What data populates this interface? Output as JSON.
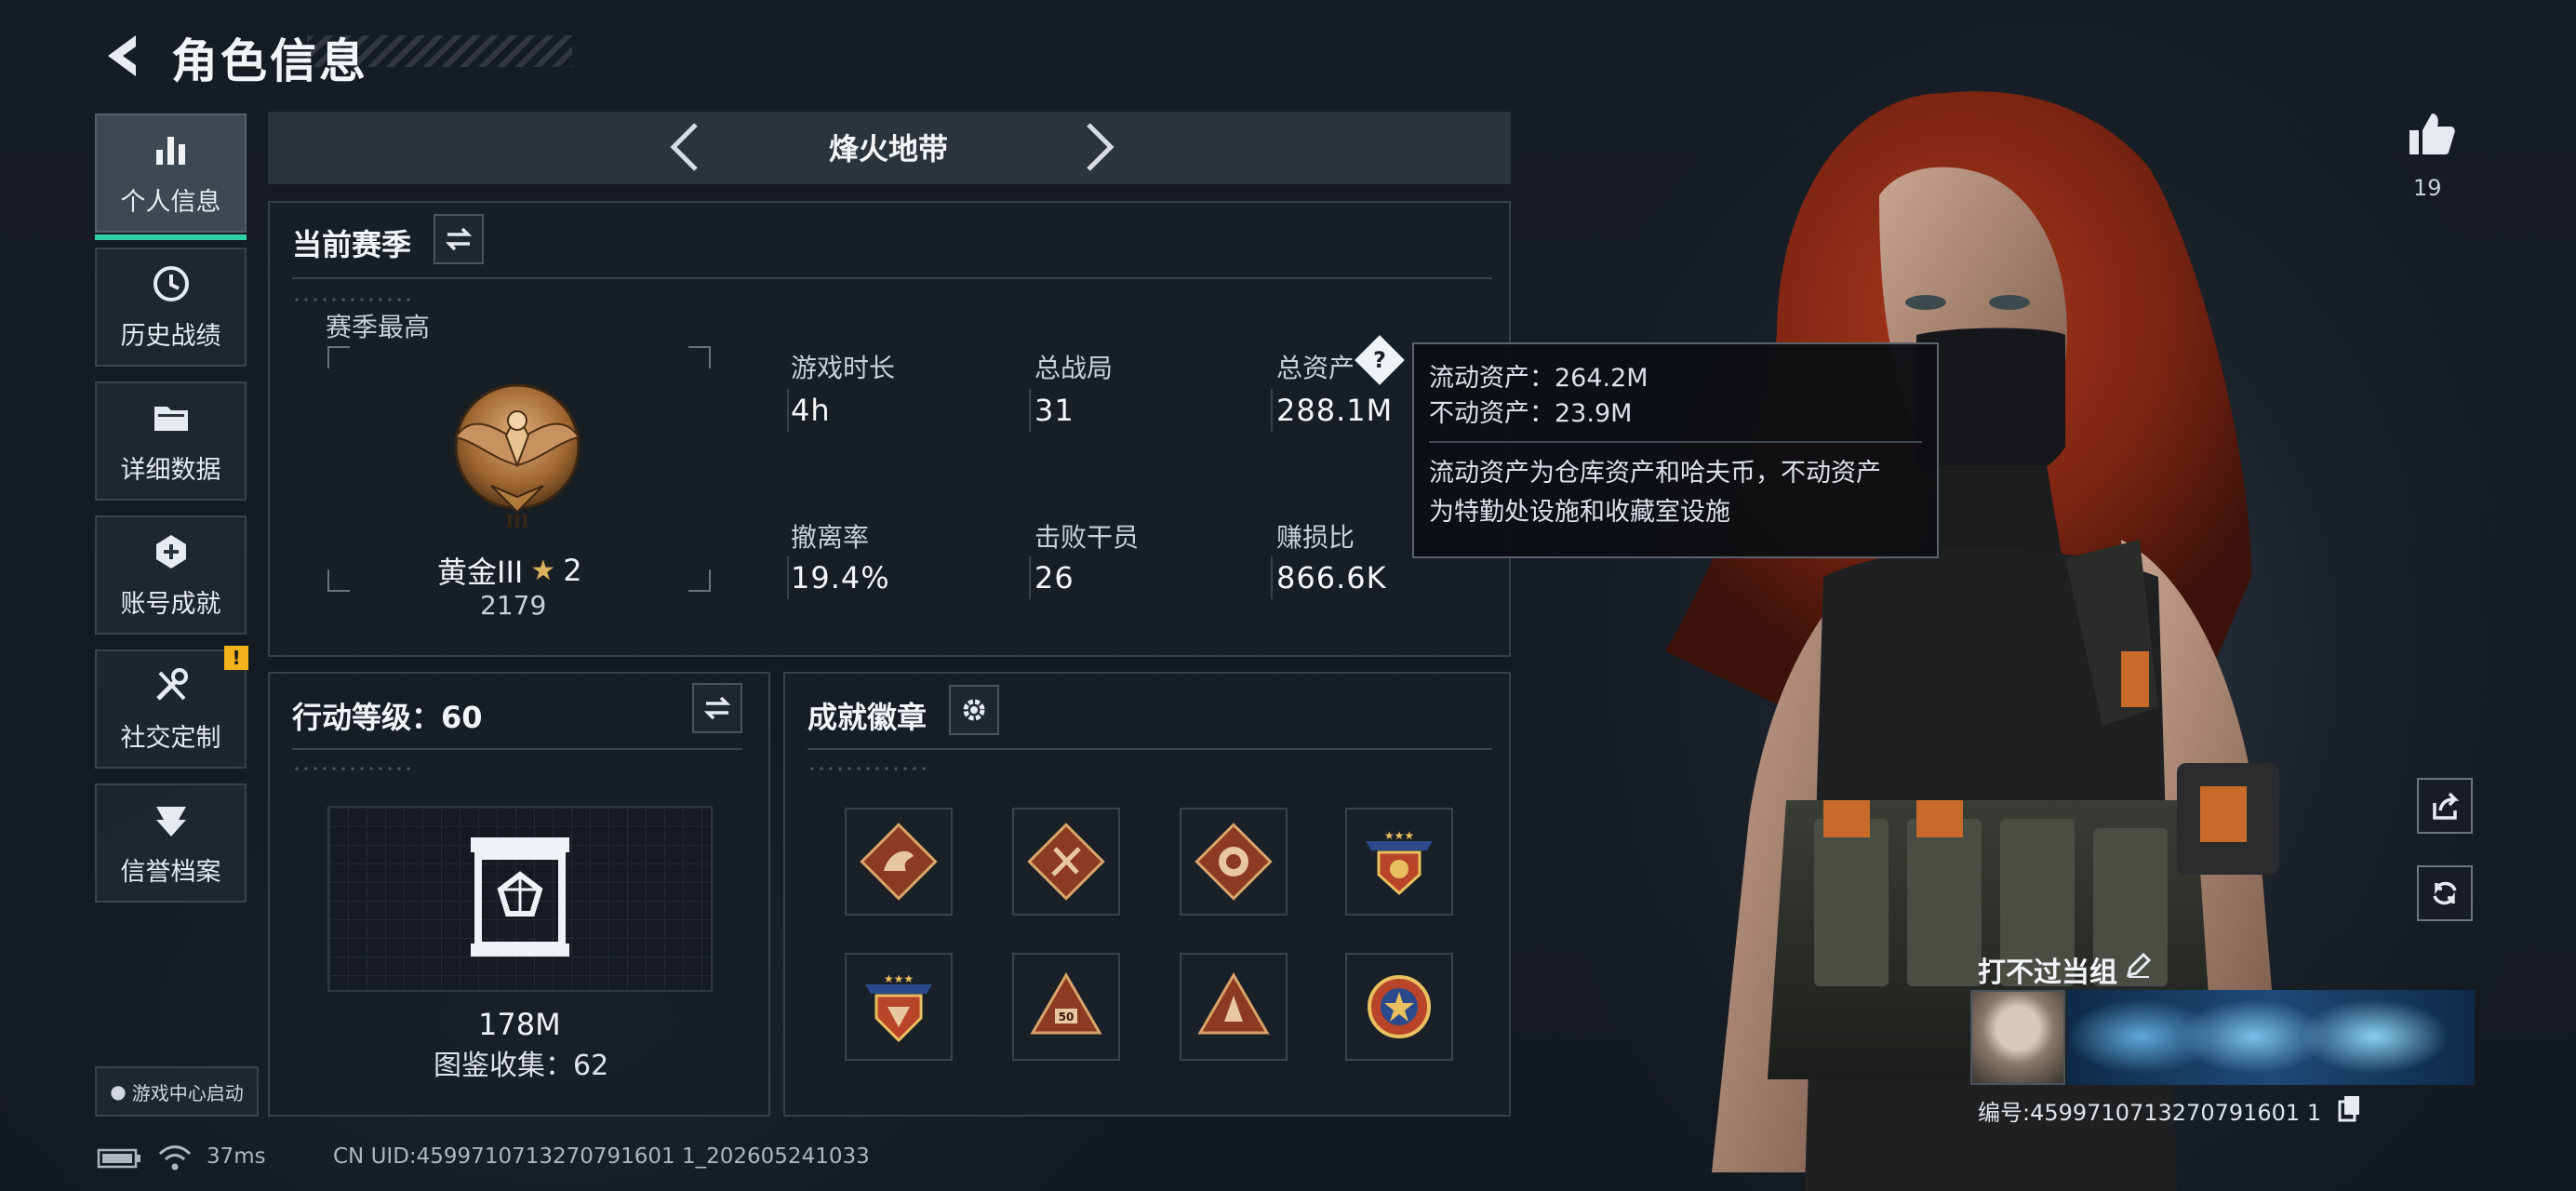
{
  "header": {
    "title": "角色信息"
  },
  "sidebar": {
    "items": [
      {
        "label": "个人信息"
      },
      {
        "label": "历史战绩"
      },
      {
        "label": "详细数据"
      },
      {
        "label": "账号成就"
      },
      {
        "label": "社交定制",
        "badge": "!"
      },
      {
        "label": "信誉档案"
      }
    ],
    "launch": "游戏中心启动"
  },
  "mode": {
    "title": "烽火地带"
  },
  "season": {
    "title": "当前赛季",
    "best_label": "赛季最高",
    "rank_name": "黄金III",
    "rank_stars": "2",
    "rank_score": "2179",
    "stats": [
      {
        "label": "游戏时长",
        "value": "4h"
      },
      {
        "label": "总战局",
        "value": "31"
      },
      {
        "label": "总资产",
        "value": "288.1M"
      },
      {
        "label": "撤离率",
        "value": "19.4%"
      },
      {
        "label": "击败干员",
        "value": "26"
      },
      {
        "label": "赚损比",
        "value": "866.6K"
      }
    ]
  },
  "tooltip": {
    "line1": "流动资产：264.2M",
    "line2": "不动资产：23.9M",
    "desc1": "流动资产为仓库资产和哈夫币，不动资产",
    "desc2": "为特勤处设施和收藏室设施"
  },
  "action_level": {
    "title": "行动等级：60",
    "value": "178M",
    "collection": "图鉴收集：62"
  },
  "achievements": {
    "title": "成就徽章",
    "badges": [
      "dragon-badge",
      "tools-badge",
      "lion-badge",
      "winged-shield-badge",
      "eagle-shield-badge",
      "pyramid-badge",
      "triangle-badge",
      "star-medal-badge"
    ],
    "badge_text": "50"
  },
  "likes": {
    "count": "19"
  },
  "player": {
    "name": "打不过当组",
    "id": "编号:4599710713270791601 1"
  },
  "status": {
    "ping": "37ms",
    "uid": "CN UID:4599710713270791601 1_202605241033"
  },
  "colors": {
    "accent": "#2fd2a8",
    "warning": "#f2b21a",
    "bronze": "#b07a3c",
    "panel_border": "#38414a"
  }
}
